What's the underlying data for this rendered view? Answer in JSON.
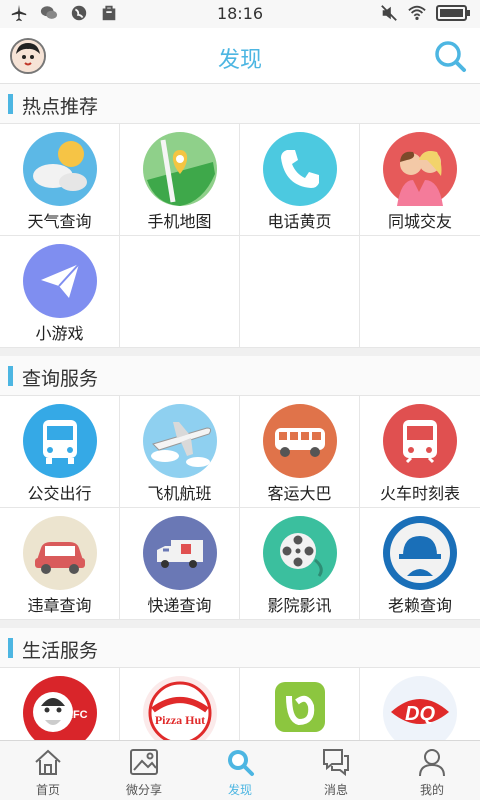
{
  "status": {
    "time": "18:16"
  },
  "header": {
    "title": "发现"
  },
  "sections": [
    {
      "title": "热点推荐",
      "items": [
        "天气查询",
        "手机地图",
        "电话黄页",
        "同城交友",
        "小游戏"
      ]
    },
    {
      "title": "查询服务",
      "items": [
        "公交出行",
        "飞机航班",
        "客运大巴",
        "火车时刻表",
        "违章查询",
        "快递查询",
        "影院影讯",
        "老赖查询"
      ]
    },
    {
      "title": "生活服务",
      "items": [
        "肯德基",
        "必胜客",
        "点评",
        "冰雪皇后"
      ],
      "logo_text": [
        "KFC",
        "Pizza Hut",
        "DQ"
      ]
    }
  ],
  "tabs": [
    {
      "label": "首页",
      "icon": "home-icon"
    },
    {
      "label": "微分享",
      "icon": "image-share-icon"
    },
    {
      "label": "发现",
      "icon": "search-icon",
      "active": true
    },
    {
      "label": "消息",
      "icon": "chat-icon"
    },
    {
      "label": "我的",
      "icon": "user-icon"
    }
  ],
  "colors": {
    "accent": "#4db6e2"
  }
}
